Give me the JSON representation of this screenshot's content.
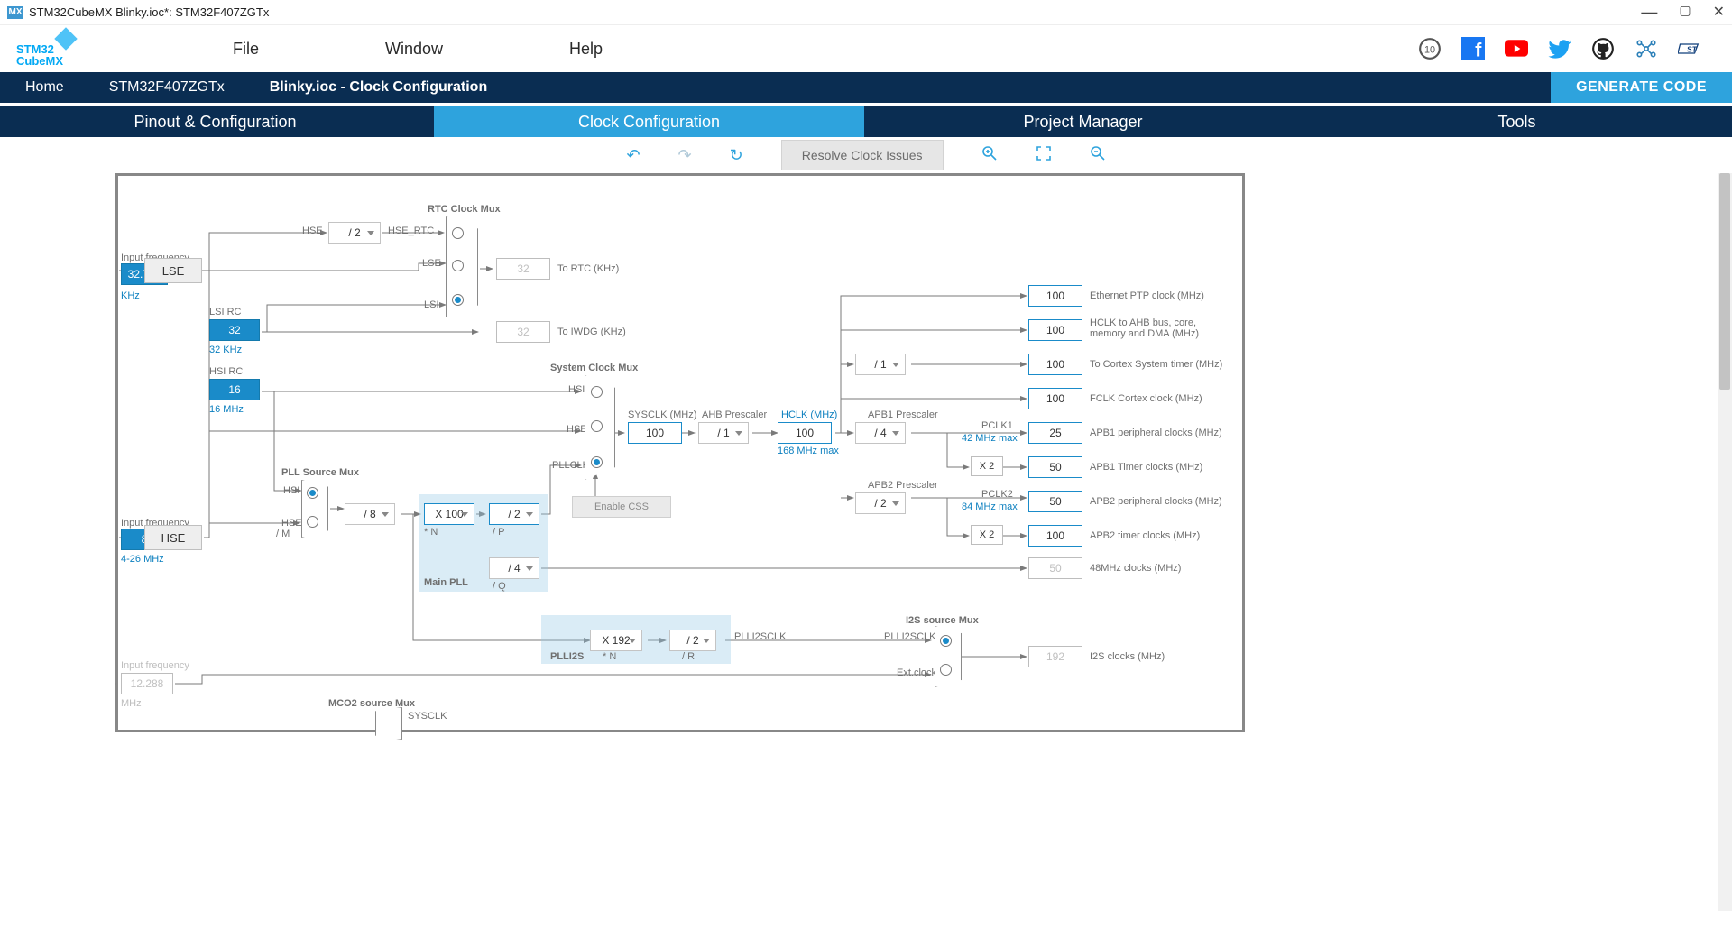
{
  "window": {
    "title": "STM32CubeMX Blinky.ioc*: STM32F407ZGTx"
  },
  "menu": {
    "file": "File",
    "window": "Window",
    "help": "Help"
  },
  "breadcrumb": {
    "home": "Home",
    "device": "STM32F407ZGTx",
    "page": "Blinky.ioc - Clock Configuration",
    "generate": "GENERATE CODE"
  },
  "tabs": {
    "pinout": "Pinout & Configuration",
    "clock": "Clock Configuration",
    "project": "Project Manager",
    "tools": "Tools"
  },
  "toolbar": {
    "resolve": "Resolve Clock Issues"
  },
  "labels": {
    "inputfreq": "Input frequency",
    "khz": "KHz",
    "mhz": "MHz",
    "range426": "4-26 MHz",
    "lsirc": "LSI RC",
    "lsirc_sub": "32 KHz",
    "hsirc": "HSI RC",
    "hsirc_sub": "16 MHz",
    "rtcmux": "RTC Clock Mux",
    "tortc": "To RTC (KHz)",
    "toiwdg": "To IWDG (KHz)",
    "hse": "HSE",
    "lse": "LSE",
    "lsi": "LSI",
    "hsi": "HSI",
    "hse_rtc": "HSE_RTC",
    "pllsrc": "PLL Source Mux",
    "divm": "/ M",
    "muln": "* N",
    "divp": "/ P",
    "divq": "/ Q",
    "divr": "/ R",
    "mainpll": "Main PLL",
    "plli2s": "PLLI2S",
    "sysmux": "System Clock Mux",
    "pllclk": "PLLCLK",
    "sysclk": "SYSCLK (MHz)",
    "ahbpre": "AHB Prescaler",
    "hclk": "HCLK (MHz)",
    "hclk_max": "168 MHz max",
    "apb1pre": "APB1 Prescaler",
    "apb2pre": "APB2 Prescaler",
    "pclk1": "PCLK1",
    "pclk2": "PCLK2",
    "pclk1_max": "42 MHz max",
    "pclk2_max": "84 MHz max",
    "enablecss": "Enable CSS",
    "eth": "Ethernet PTP clock (MHz)",
    "hclk_ahb": "HCLK to AHB bus, core, memory and DMA (MHz)",
    "cortex_timer": "To Cortex System timer (MHz)",
    "fclk": "FCLK Cortex clock (MHz)",
    "apb1_periph": "APB1 peripheral clocks (MHz)",
    "apb1_timer": "APB1 Timer clocks (MHz)",
    "apb2_periph": "APB2 peripheral clocks (MHz)",
    "apb2_timer": "APB2 timer clocks (MHz)",
    "clk48": "48MHz clocks (MHz)",
    "i2s": "I2S clocks (MHz)",
    "i2ssrc": "I2S source Mux",
    "plli2sclk": "PLLI2SCLK",
    "extclock": "Ext.clock",
    "mco2": "MCO2 source Mux",
    "sysclk_s": "SYSCLK"
  },
  "values": {
    "lse_in": "32.768",
    "lsi": "32",
    "hsi": "16",
    "hse_in": "8",
    "i2s_in": "12.288",
    "hse_div": "/ 2",
    "rtc_out": "32",
    "iwdg_out": "32",
    "pllm": "/ 8",
    "plln": "X 100",
    "pllp": "/ 2",
    "pllq": "/ 4",
    "plli2s_n": "X 192",
    "plli2s_r": "/ 2",
    "sysclk": "100",
    "ahb": "/ 1",
    "hclk": "100",
    "cortex_div": "/ 1",
    "apb1": "/ 4",
    "apb2": "/ 2",
    "x2": "X 2",
    "out_eth": "100",
    "out_hclk": "100",
    "out_cortex": "100",
    "out_fclk": "100",
    "out_apb1p": "25",
    "out_apb1t": "50",
    "out_apb2p": "50",
    "out_apb2t": "100",
    "out_48": "50",
    "out_i2s": "192"
  }
}
